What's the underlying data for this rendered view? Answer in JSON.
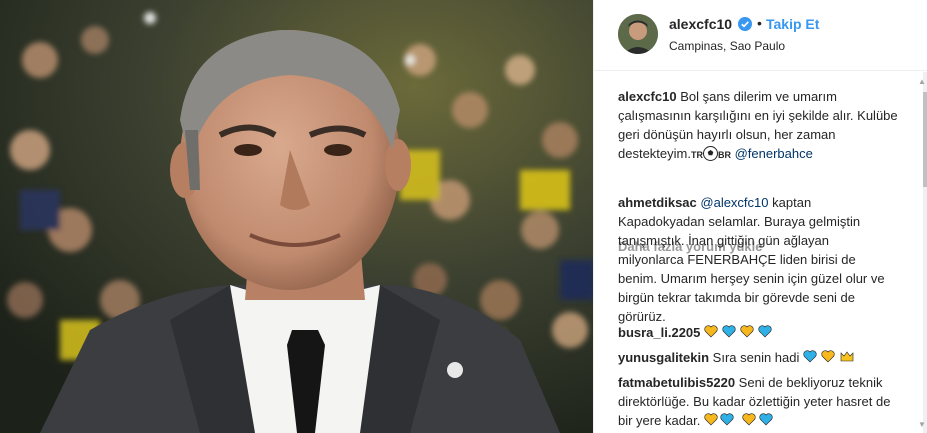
{
  "post": {
    "username": "alexcfc10",
    "follow_label": "Takip Et",
    "separator": "•",
    "location": "Campinas, Sao Paulo"
  },
  "caption": {
    "username": "alexcfc10",
    "text": "Bol şans dilerim ve umarım çalışmasının karşılığını en iyi şekilde alır. Kulübe geri dönüşün hayırlı olsun, her zaman destekteyim.",
    "flag_tr": "TR",
    "flag_br": "BR",
    "mention": "@fenerbahce"
  },
  "load_more_label": "Daha fazla yorum yükle",
  "comments": [
    {
      "username": "ahmetdiksac",
      "mention": "@alexcfc10",
      "text": "kaptan Kapadokyadan selamlar. Buraya gelmiştin tanışmıştık. İnan gittiğin gün ağlayan milyonlarca FENERBAHÇE liden birisi de benim. Umarım herşey senin için güzel olur ve birgün tekrar takımda bir görevde seni de görürüz."
    },
    {
      "username": "busra_li.2205",
      "text": "",
      "emoji": [
        "yellow-heart",
        "blue-heart",
        "yellow-heart",
        "blue-heart"
      ]
    },
    {
      "username": "yunusgalitekin",
      "text": "Sıra senin hadi",
      "emoji": [
        "blue-heart",
        "yellow-heart",
        "crown"
      ]
    },
    {
      "username": "fatmabetulibis5220",
      "text": "Seni de bekliyoruz teknik direktörlüğe. Bu kadar özlettiğin yeter hasret de bir yere kadar.",
      "emoji": [
        "yellow-heart",
        "blue-heart",
        "yellow-heart",
        "blue-heart"
      ]
    }
  ],
  "colors": {
    "link": "#3897f0",
    "mention": "#003569",
    "heart_yellow": "#f7b81e",
    "heart_blue": "#2fb0e6"
  }
}
